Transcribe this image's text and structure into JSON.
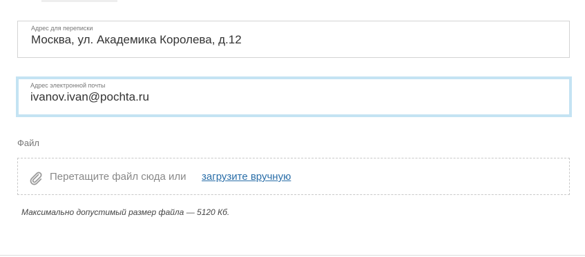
{
  "address_field": {
    "label": "Адрес для переписки",
    "value": "Москва, ул. Академика Королева, д.12"
  },
  "email_field": {
    "label": "Адрес электронной почты",
    "value": "ivanov.ivan@pochta.ru"
  },
  "file_section": {
    "label": "Файл",
    "dropzone_text": "Перетащите файл сюда или",
    "upload_link": "загрузите вручную",
    "icon": "paperclip-icon",
    "hint": "Максимально допустимый размер файла — 5120 Кб."
  },
  "colors": {
    "focus_border": "#c4e3f3",
    "link": "#2a6ea8"
  }
}
